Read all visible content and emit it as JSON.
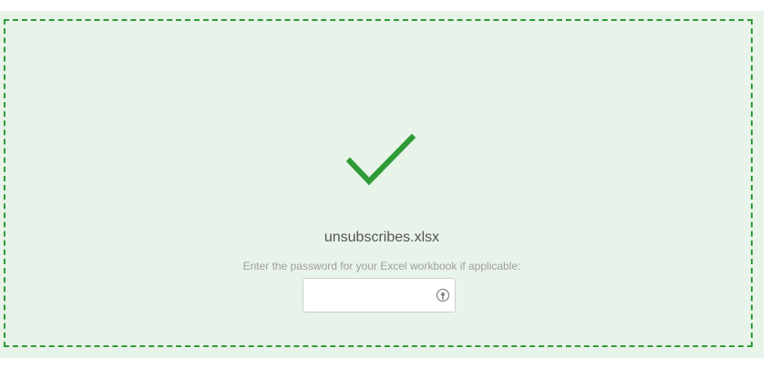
{
  "upload": {
    "status_icon": "checkmark-icon",
    "filename": "unsubscribes.xlsx",
    "password_hint": "Enter the password for your Excel workbook if applicable:",
    "password_value": "",
    "password_placeholder": "",
    "reveal_icon": "eye-icon"
  },
  "colors": {
    "accent": "#2f9b37",
    "background": "#e8f3e9"
  }
}
